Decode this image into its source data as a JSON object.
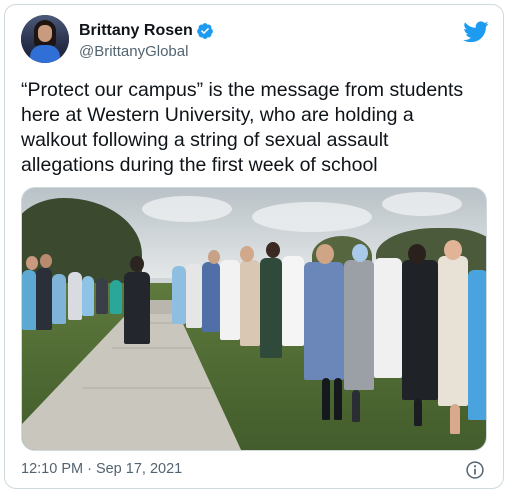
{
  "author": {
    "display_name": "Brittany Rosen",
    "handle": "@BrittanyGlobal",
    "verified": true,
    "avatar_icon": "profile-photo"
  },
  "tweet": {
    "text_lines": [
      "“Protect our campus” is the message from students",
      "here at Western University, who are holding a",
      "walkout following a string of sexual assault",
      "allegations during the first week of school"
    ],
    "media_type": "photo",
    "timestamp": "12:10 PM · Sep 17, 2021"
  },
  "icons": {
    "brand": "twitter-bird-icon",
    "verified": "verified-badge-icon",
    "info": "info-icon"
  },
  "colors": {
    "brand_blue": "#1d9bf0",
    "text_primary": "#0f1419",
    "text_secondary": "#536471",
    "border": "#cfd9de"
  }
}
